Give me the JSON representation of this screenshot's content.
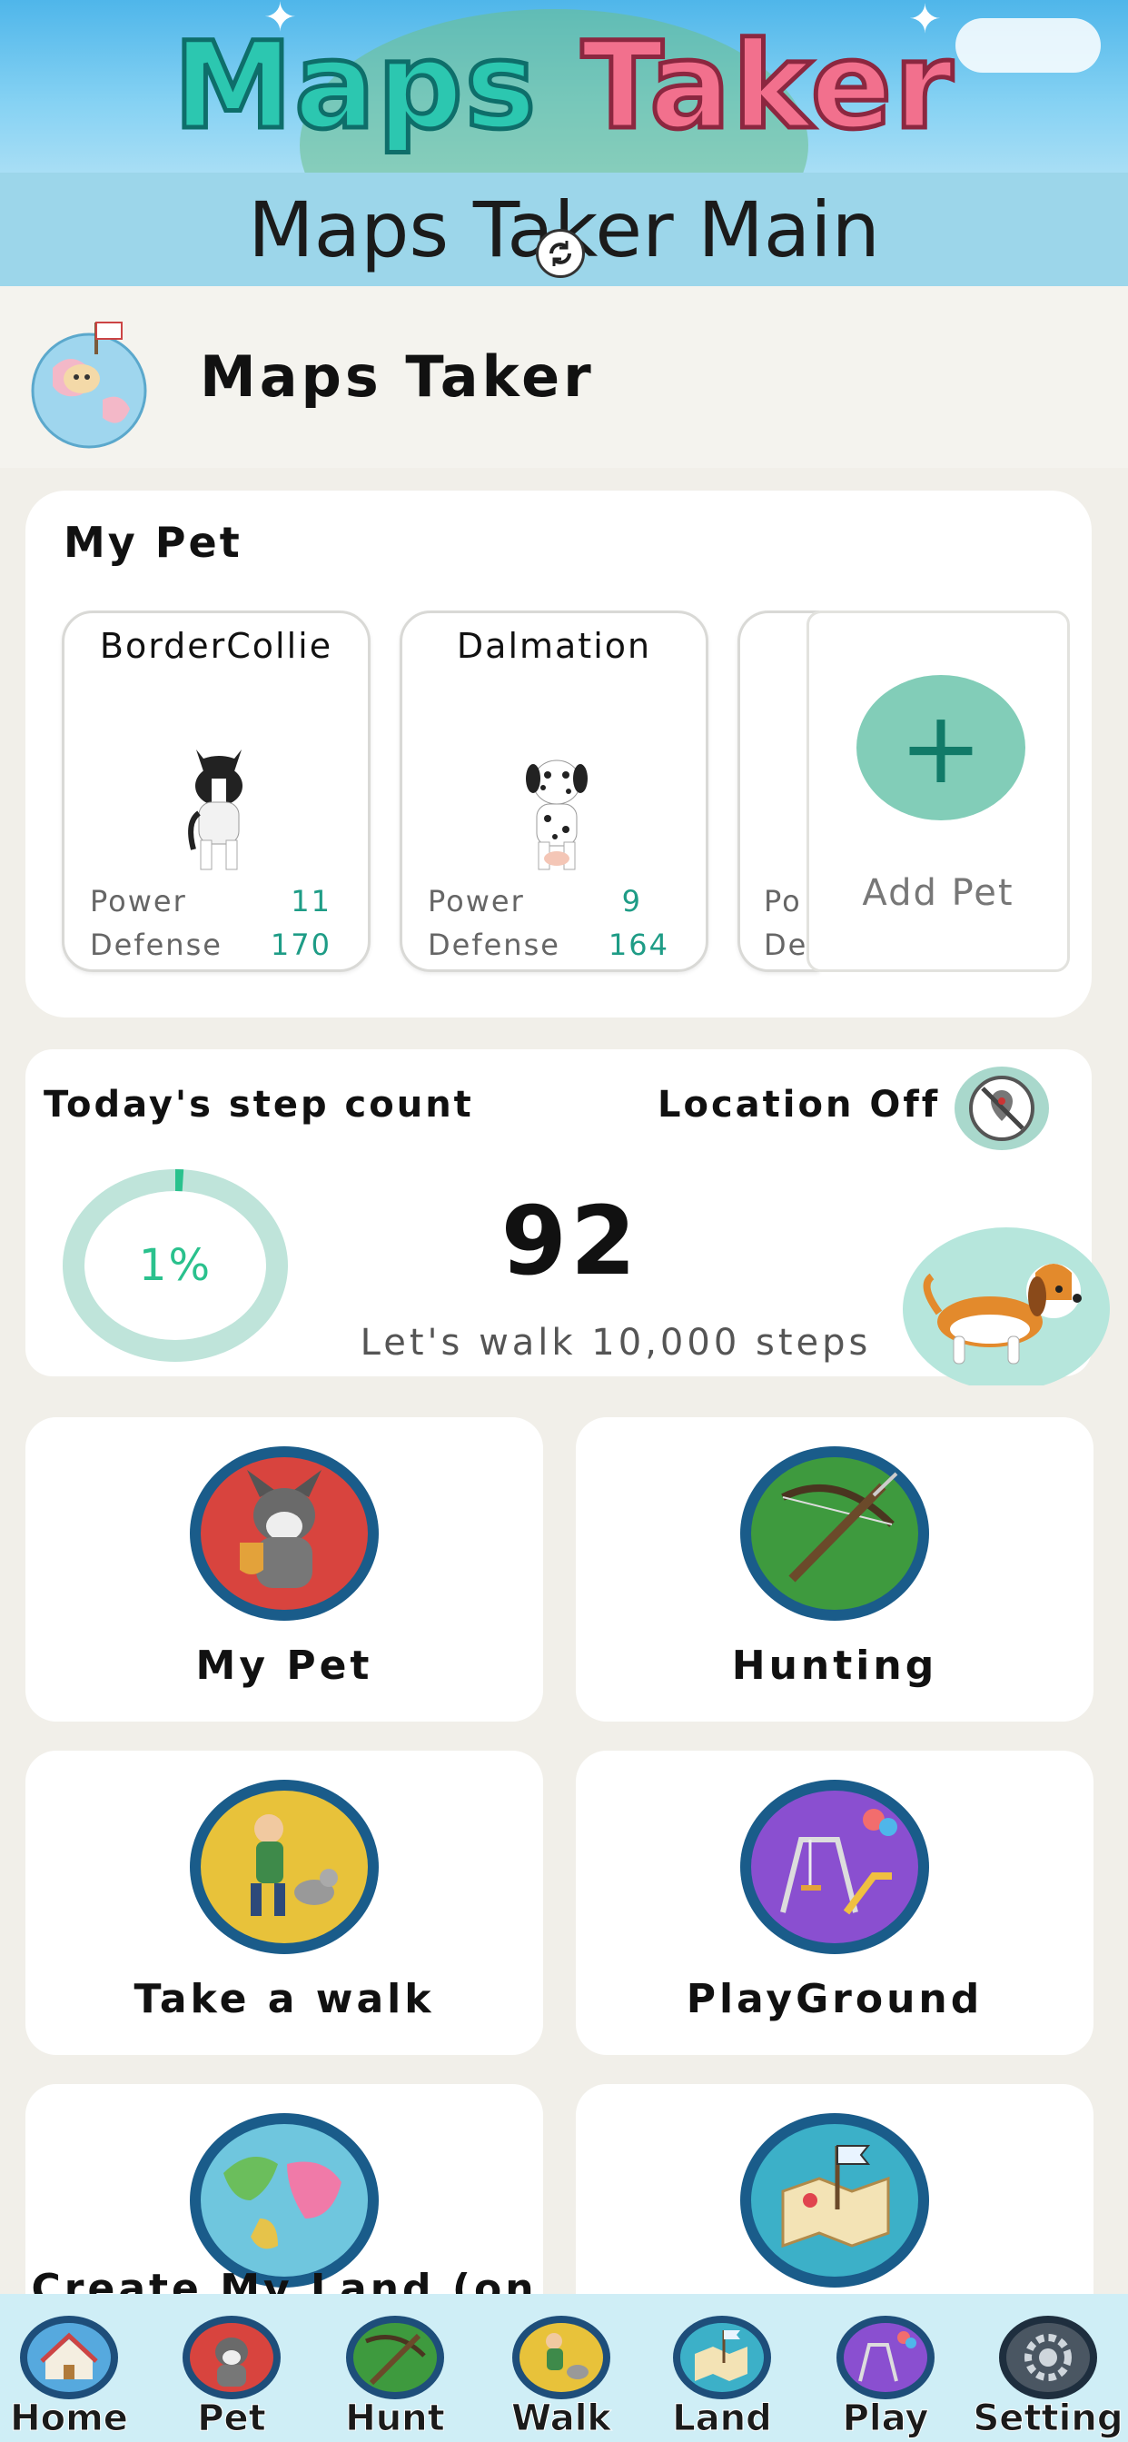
{
  "banner": {
    "word1": "Maps",
    "word2": "Taker"
  },
  "subtitle": "Maps Taker Main",
  "header": {
    "app_name": "Maps Taker"
  },
  "my_pet": {
    "title": "My Pet",
    "pets": [
      {
        "name": "BorderCollie",
        "power_label": "Power",
        "power": "11",
        "defense_label": "Defense",
        "defense": "170"
      },
      {
        "name": "Dalmation",
        "power_label": "Power",
        "power": "9",
        "defense_label": "Defense",
        "defense": "164"
      }
    ],
    "partial_card": {
      "power_label": "Po",
      "defense_label": "De"
    },
    "add_label": "Add Pet",
    "add_symbol": "+"
  },
  "steps": {
    "title": "Today's step count",
    "location_label": "Location Off",
    "percent_label": "1%",
    "percent": 0.01,
    "count": "92",
    "hint": "Let's walk 10,000 steps"
  },
  "menu": [
    {
      "label": "My Pet",
      "icon": "husky-icon",
      "color": "#D8443E"
    },
    {
      "label": "Hunting",
      "icon": "crossbow-icon",
      "color": "#3E9A3E"
    },
    {
      "label": "Take a walk",
      "icon": "hiker-icon",
      "color": "#E8C23A"
    },
    {
      "label": "PlayGround",
      "icon": "playground-icon",
      "color": "#8A4FD0"
    },
    {
      "label": "Create My Land (on",
      "icon": "world-map-icon",
      "color": "#3CB0C8"
    },
    {
      "label": "",
      "icon": "treasure-map-icon",
      "color": "#3CB0C8"
    }
  ],
  "nav": [
    {
      "label": "Home",
      "icon": "home-icon",
      "color": "#56A9DE"
    },
    {
      "label": "Pet",
      "icon": "husky-icon",
      "color": "#D8443E"
    },
    {
      "label": "Hunt",
      "icon": "crossbow-icon",
      "color": "#3E9A3E"
    },
    {
      "label": "Walk",
      "icon": "hiker-icon",
      "color": "#E8C23A"
    },
    {
      "label": "Land",
      "icon": "treasure-map-icon",
      "color": "#3CB0C8"
    },
    {
      "label": "Play",
      "icon": "playground-icon",
      "color": "#8A4FD0"
    },
    {
      "label": "Setting",
      "icon": "settings-icon",
      "color": "#4A5662"
    }
  ],
  "colors": {
    "accent": "#1E9C86",
    "progress": "#2AC18D",
    "ring_track": "#BFE4DA"
  }
}
